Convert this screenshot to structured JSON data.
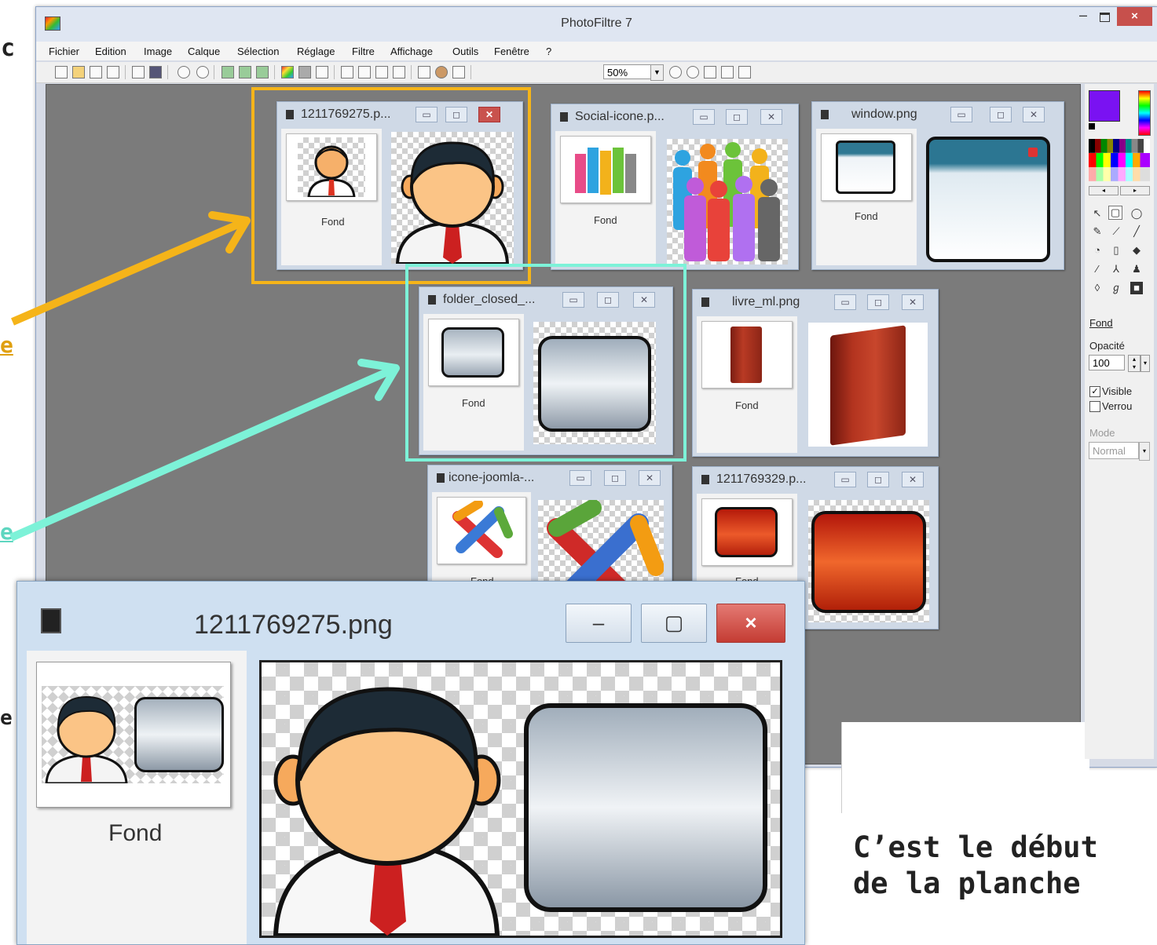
{
  "app": {
    "title": "PhotoFiltre 7",
    "menu": [
      "Fichier",
      "Edition",
      "Image",
      "Calque",
      "Sélection",
      "Réglage",
      "Filtre",
      "Affichage",
      "Outils",
      "Fenêtre",
      "?"
    ],
    "zoom": "50%",
    "close_glyph": "×",
    "min_glyph": "–"
  },
  "side_text": {
    "top": "c",
    "link1": "e",
    "link2": "e",
    "mid": "e"
  },
  "documents": [
    {
      "title": "1211769275.p...",
      "layer": "Fond"
    },
    {
      "title": "Social-icone.p...",
      "layer": "Fond"
    },
    {
      "title": "window.png",
      "layer": "Fond"
    },
    {
      "title": "folder_closed_...",
      "layer": "Fond"
    },
    {
      "title": "livre_ml.png",
      "layer": "Fond"
    },
    {
      "title": "icone-joomla-...",
      "layer": "Fond"
    },
    {
      "title": "1211769329.p...",
      "layer": "Fond"
    }
  ],
  "layer_panel": {
    "layer_name": "Fond",
    "opacity_label": "Opacité",
    "opacity_value": "100",
    "visible_label": "Visible",
    "lock_label": "Verrou",
    "mode_label": "Mode",
    "mode_value": "Normal"
  },
  "zoom_window": {
    "title": "1211769275.png",
    "layer": "Fond"
  },
  "caption": {
    "line1": "C’est le début",
    "line2": "de la planche"
  },
  "colors": {
    "highlight_orange": "#f5b419",
    "highlight_cyan": "#7df2d8",
    "primary_color": "#7a12f2"
  }
}
